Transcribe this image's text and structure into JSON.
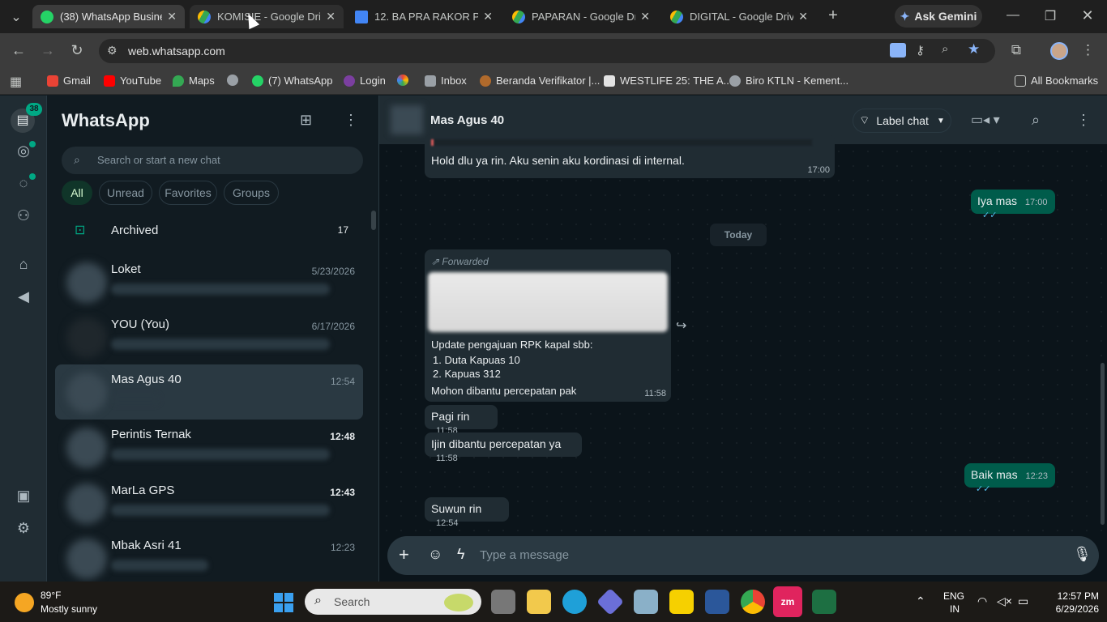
{
  "browser": {
    "tabs": [
      {
        "title": "(38) WhatsApp Busines",
        "active": true
      },
      {
        "title": "KOMISIE - Google Drive",
        "active": false
      },
      {
        "title": "12. BA PRA RAKOR PER",
        "active": false
      },
      {
        "title": "PAPARAN - Google Drive",
        "active": false
      },
      {
        "title": "DIGITAL - Google Drive",
        "active": false
      }
    ],
    "new_tab": "+",
    "gemini": "Ask Gemini",
    "url": "web.whatsapp.com",
    "bookmarks": [
      "Gmail",
      "YouTube",
      "Maps",
      "(7) WhatsApp",
      "Login",
      "Inbox",
      "Beranda Verifikator |...",
      "WESTLIFE 25: THE A...",
      "Biro KTLN - Kement..."
    ],
    "all_bookmarks": "All Bookmarks"
  },
  "rail": {
    "badge": "38"
  },
  "sidebar": {
    "title": "WhatsApp",
    "search_placeholder": "Search or start a new chat",
    "filters": [
      "All",
      "Unread",
      "Favorites",
      "Groups"
    ],
    "archived": {
      "label": "Archived",
      "count": "17"
    },
    "chats": [
      {
        "name": "Loket",
        "time": "5/23/2026"
      },
      {
        "name": "YOU (You)",
        "time": "6/17/2026"
      },
      {
        "name": "Mas Agus 40",
        "time": "12:54",
        "selected": true
      },
      {
        "name": "Perintis Ternak",
        "time": "12:48"
      },
      {
        "name": "MarLa GPS",
        "time": "12:43"
      },
      {
        "name": "Mbak Asri 41",
        "time": "12:23"
      }
    ]
  },
  "chat": {
    "contact": "Mas Agus 40",
    "label_chat": "Label chat",
    "msg_top": {
      "text": "Hold dlu ya rin. Aku senin aku kordinasi di internal.",
      "time": "17:00"
    },
    "msg_out1": {
      "text": "Iya mas",
      "time": "17:00"
    },
    "day_sep": "Today",
    "forward": {
      "tag": "Forwarded",
      "line1": "Update pengajuan RPK kapal sbb:",
      "item1": "Duta Kapuas 10",
      "item2": "Kapuas 312",
      "line2": "Mohon dibantu percepatan pak",
      "time": "11:58"
    },
    "msg_in2": {
      "text": "Pagi rin",
      "time": "11:58"
    },
    "msg_in3": {
      "text": "Ijin dibantu percepatan ya",
      "time": "11:58"
    },
    "msg_out2": {
      "text": "Baik mas",
      "time": "12:23"
    },
    "msg_in4": {
      "text": "Suwun rin",
      "time": "12:54"
    },
    "composer_placeholder": "Type a message"
  },
  "taskbar": {
    "weather_temp": "89°F",
    "weather_desc": "Mostly sunny",
    "search": "Search",
    "lang1": "ENG",
    "lang2": "IN",
    "time": "12:57 PM",
    "date": "6/29/2026"
  },
  "colors": {
    "wa_green": "#00a884",
    "outgoing": "#005c4b",
    "incoming": "#202c33"
  }
}
